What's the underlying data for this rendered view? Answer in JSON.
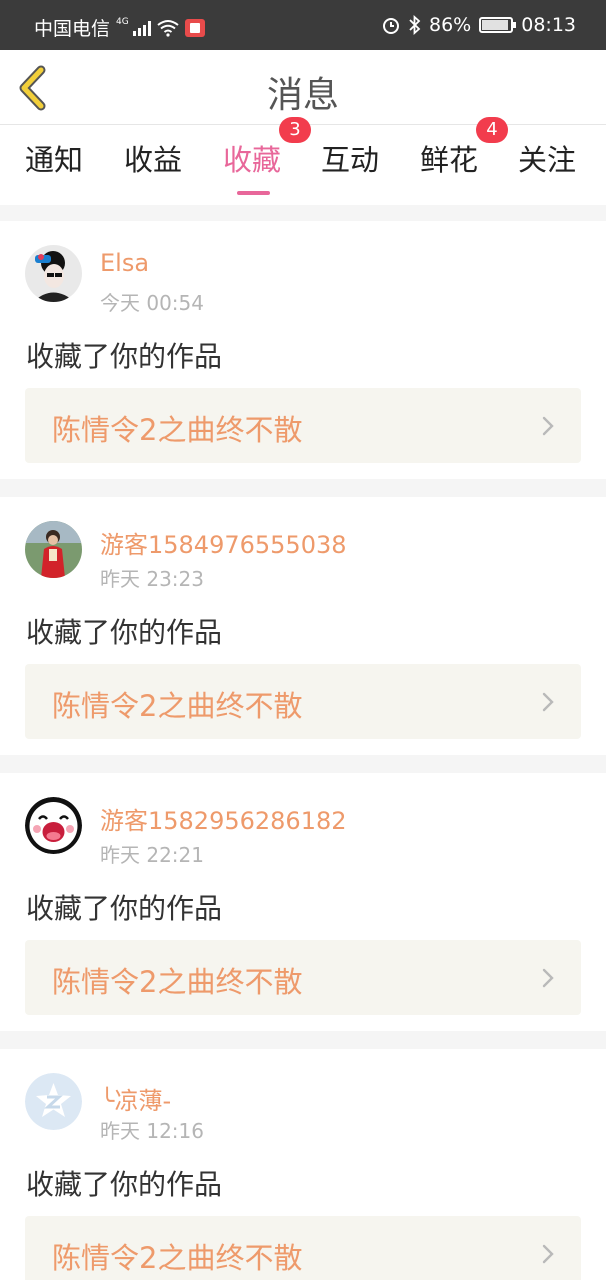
{
  "status_bar": {
    "carrier": "中国电信",
    "network": "4G",
    "battery_pct": "86%",
    "time": "08:13",
    "icons": [
      "signal-icon",
      "wifi-icon",
      "app-notification-icon",
      "alarm-icon",
      "bluetooth-icon",
      "battery-icon"
    ]
  },
  "header": {
    "title": "消息",
    "back_icon": "chevron-left-icon"
  },
  "tabs": [
    {
      "label": "通知",
      "badge": null,
      "active": false
    },
    {
      "label": "收益",
      "badge": null,
      "active": false
    },
    {
      "label": "收藏",
      "badge": "3",
      "active": true
    },
    {
      "label": "互动",
      "badge": null,
      "active": false
    },
    {
      "label": "鲜花",
      "badge": "4",
      "active": false
    },
    {
      "label": "关注",
      "badge": null,
      "active": false
    }
  ],
  "messages": [
    {
      "user": "Elsa",
      "time": "今天 00:54",
      "action": "收藏了你的作品",
      "work": "陈情令2之曲终不散",
      "avatar": "avatar-elsa"
    },
    {
      "user": "游客1584976555038",
      "time": "昨天 23:23",
      "action": "收藏了你的作品",
      "work": "陈情令2之曲终不散",
      "avatar": "avatar-photo"
    },
    {
      "user": "游客1582956286182",
      "time": "昨天 22:21",
      "action": "收藏了你的作品",
      "work": "陈情令2之曲终不散",
      "avatar": "avatar-cartoon"
    },
    {
      "user": "╰凉薄-",
      "time": "昨天 12:16",
      "action": "收藏了你的作品",
      "work": "陈情令2之曲终不散",
      "avatar": "avatar-default"
    }
  ],
  "colors": {
    "accent_pink": "#e8679a",
    "username_orange": "#ee9a6b",
    "badge_red": "#f23c4d",
    "work_bg": "#f6f5ef"
  }
}
